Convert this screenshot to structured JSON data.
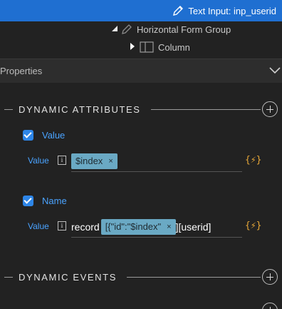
{
  "header": {
    "title": "Text Input: inp_userid",
    "icon": "pencil-icon"
  },
  "tree": {
    "parent_label": "Horizontal Form Group",
    "child_label": "Column"
  },
  "properties": {
    "title": "Properties"
  },
  "dynamic_attributes": {
    "title": "DYNAMIC ATTRIBUTES",
    "items": [
      {
        "checkbox_label": "Value",
        "checked": true,
        "field_label": "Value",
        "tag": "$index",
        "prefix": "",
        "suffix": ""
      },
      {
        "checkbox_label": "Name",
        "checked": true,
        "field_label": "Value",
        "prefix": "record",
        "tag": "[{\"id\":\"$index\"",
        "suffix": "][userid]"
      }
    ],
    "bolt_symbol": "{⚡}",
    "tag_remove": "×"
  },
  "dynamic_events": {
    "title": "DYNAMIC EVENTS"
  },
  "colors": {
    "accent": "#1f6fd1",
    "link": "#4aa3ff",
    "tag_bg": "#6aa9c4",
    "bolt": "#e8a838"
  }
}
